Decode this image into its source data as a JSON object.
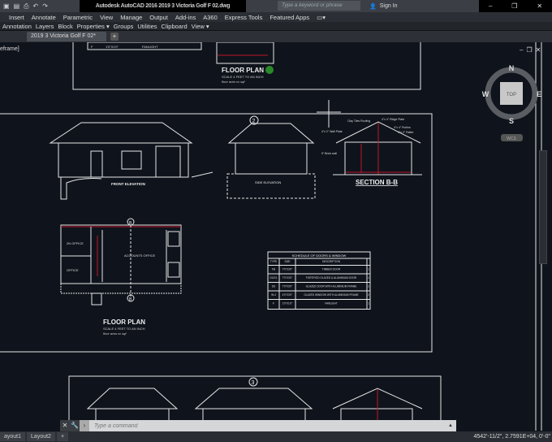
{
  "titlebar": {
    "title": "Autodesk AutoCAD 2016   2019 3 Victoria Golf F 02.dwg",
    "search_placeholder": "Type a keyword or phrase",
    "sign_in": "Sign In"
  },
  "ribbon": {
    "tabs": [
      "Insert",
      "Annotate",
      "Parametric",
      "View",
      "Manage",
      "Output",
      "Add-ins",
      "A360",
      "Express Tools",
      "Featured Apps"
    ],
    "panels": [
      "Annotation",
      "Layers",
      "Block",
      "Properties ▾",
      "Groups",
      "Utilities",
      "Clipboard",
      "View ▾"
    ]
  },
  "file_tab": {
    "name": "2019 3 Victoria Golf F 02*",
    "add": "+"
  },
  "viewport": {
    "label": "eframe]"
  },
  "viewcube": {
    "n": "N",
    "s": "S",
    "e": "E",
    "w": "W",
    "face": "TOP",
    "wcs": "WCS"
  },
  "drawing": {
    "floor_plan_title": "FLOOR PLAN",
    "scale": "SCALE 4 FEET TO AN INCH",
    "floor_area": "floor area xx sqf",
    "front_elevation": "FRONT ELEVATION",
    "side_elevation": "SIDE ELEVATION",
    "section": "SECTION B-B",
    "section_notes": [
      "Clay Tiles Roofing",
      "4\"x 4\" Ridge Plate",
      "4\"x 2\" Wall Plate",
      "4\"x 4\" Purlins",
      "4\"x 2\" Rafter",
      "9\" Brick wall"
    ],
    "rooms": [
      "2N OFFICE",
      "OFFICE",
      "ACCOUNTS OFFICE"
    ],
    "markers": [
      "2",
      "3",
      "B",
      "B"
    ],
    "schedule": {
      "title": "SCHEDULE OF DOORS & WINDOW",
      "headers": [
        "TYPE",
        "SIZE",
        "DESCRIPTION",
        ""
      ],
      "rows": [
        [
          "FB",
          "7'0\"X3'0\"",
          "TIMBER DOOR",
          "1"
        ],
        [
          "D1/D1",
          "7'0\"X3'0\"",
          "FORTIFIED GLAZED & ALUMINIUM DOOR",
          "1"
        ],
        [
          "DS",
          "7'0\"X3'0\"",
          "GLAZED DOOR WITH ALUMINIUM FRAME",
          "2"
        ],
        [
          "W-4",
          "4'0\"X3'0\"",
          "GLAZED WINDOW WITH ALUMINIUM FRAME",
          "2"
        ],
        [
          "F",
          "1'0\"X1'0\"",
          "FANLIGHT",
          "1"
        ]
      ]
    },
    "top_row": [
      "F",
      "1'0\"X1'0\"",
      "FANLIGHT",
      "1"
    ]
  },
  "command": {
    "placeholder": "Type a command"
  },
  "status": {
    "layouts": [
      "ayout1",
      "Layout2",
      "+"
    ],
    "coords": "4542'-11/2\", 2.7591E+04, 0'-0\""
  },
  "colors": {
    "background": "#0f141c",
    "lines": "#e6e6e6",
    "accent_red": "#c0152a"
  }
}
